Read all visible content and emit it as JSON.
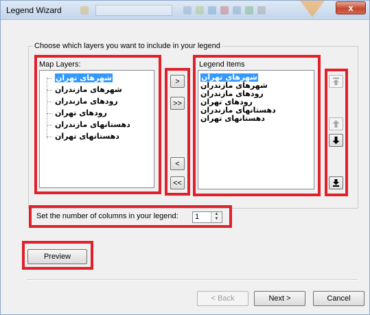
{
  "window": {
    "title": "Legend Wizard",
    "close_label": "x"
  },
  "group": {
    "caption": "Choose which layers you want to include in your legend"
  },
  "map_layers": {
    "label": "Map Layers:",
    "items": [
      "شهرهای تهران",
      "شهرهای مازندران",
      "رودهای مازندران",
      "رودهای تهران",
      "دهستانهای مازندران",
      "دهستانهای تهران"
    ],
    "selected_index": 0
  },
  "legend_items": {
    "label": "Legend Items",
    "items": [
      "شهرهای تهران",
      "شهرهای مازندران",
      "رودهای مازندران",
      "رودهای تهران",
      "دهستانهای مازندران",
      "دهستانهای تهران"
    ],
    "selected_index": 0
  },
  "transfer_buttons": {
    "add_one": ">",
    "add_all": ">>",
    "remove_one": "<",
    "remove_all": "<<"
  },
  "order_buttons": {
    "top": "move-to-top-icon",
    "up": "move-up-icon",
    "down": "move-down-icon",
    "bottom": "move-to-bottom-icon"
  },
  "columns": {
    "label": "Set the number of columns in your legend:",
    "value": "1"
  },
  "buttons": {
    "preview": "Preview",
    "back": "< Back",
    "next": "Next >",
    "cancel": "Cancel"
  },
  "colors": {
    "highlight_red": "#e0202a",
    "selection_blue": "#3399ff",
    "close_red": "#c4482f"
  }
}
